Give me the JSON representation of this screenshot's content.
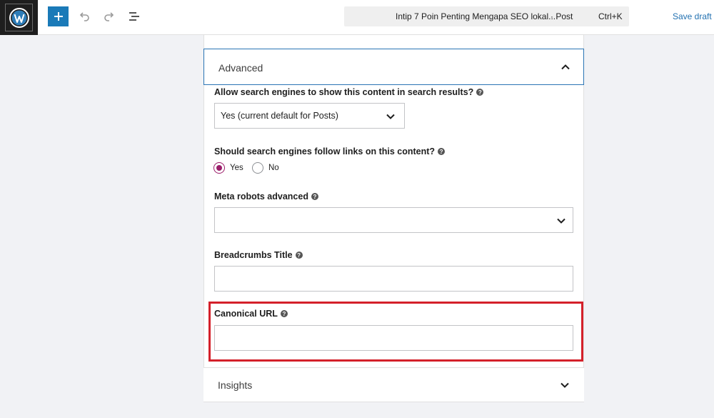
{
  "toolbar": {
    "logo_icon": "wordpress-logo-icon",
    "add_icon": "plus-icon",
    "undo_icon": "undo-icon",
    "redo_icon": "redo-icon",
    "outline_icon": "list-view-icon",
    "document_title": "Intip 7 Poin Penting Mengapa SEO lokal...",
    "document_type": "· Post",
    "command_shortcut": "Ctrl+K",
    "save_draft_label": "Save draft",
    "accent_color": "#1a7ab8"
  },
  "advanced": {
    "title": "Advanced",
    "expanded": true,
    "search_visibility": {
      "label": "Allow search engines to show this content in search results?",
      "selected": "Yes (current default for Posts)"
    },
    "follow_links": {
      "label": "Should search engines follow links on this content?",
      "options": [
        "Yes",
        "No"
      ],
      "selected": "Yes",
      "radio_color": "#9b1e6a"
    },
    "meta_robots": {
      "label": "Meta robots advanced",
      "selected": ""
    },
    "breadcrumbs_title": {
      "label": "Breadcrumbs Title",
      "value": ""
    },
    "canonical_url": {
      "label": "Canonical URL",
      "value": "",
      "highlight_color": "#d4202a"
    }
  },
  "insights": {
    "title": "Insights",
    "expanded": false
  }
}
